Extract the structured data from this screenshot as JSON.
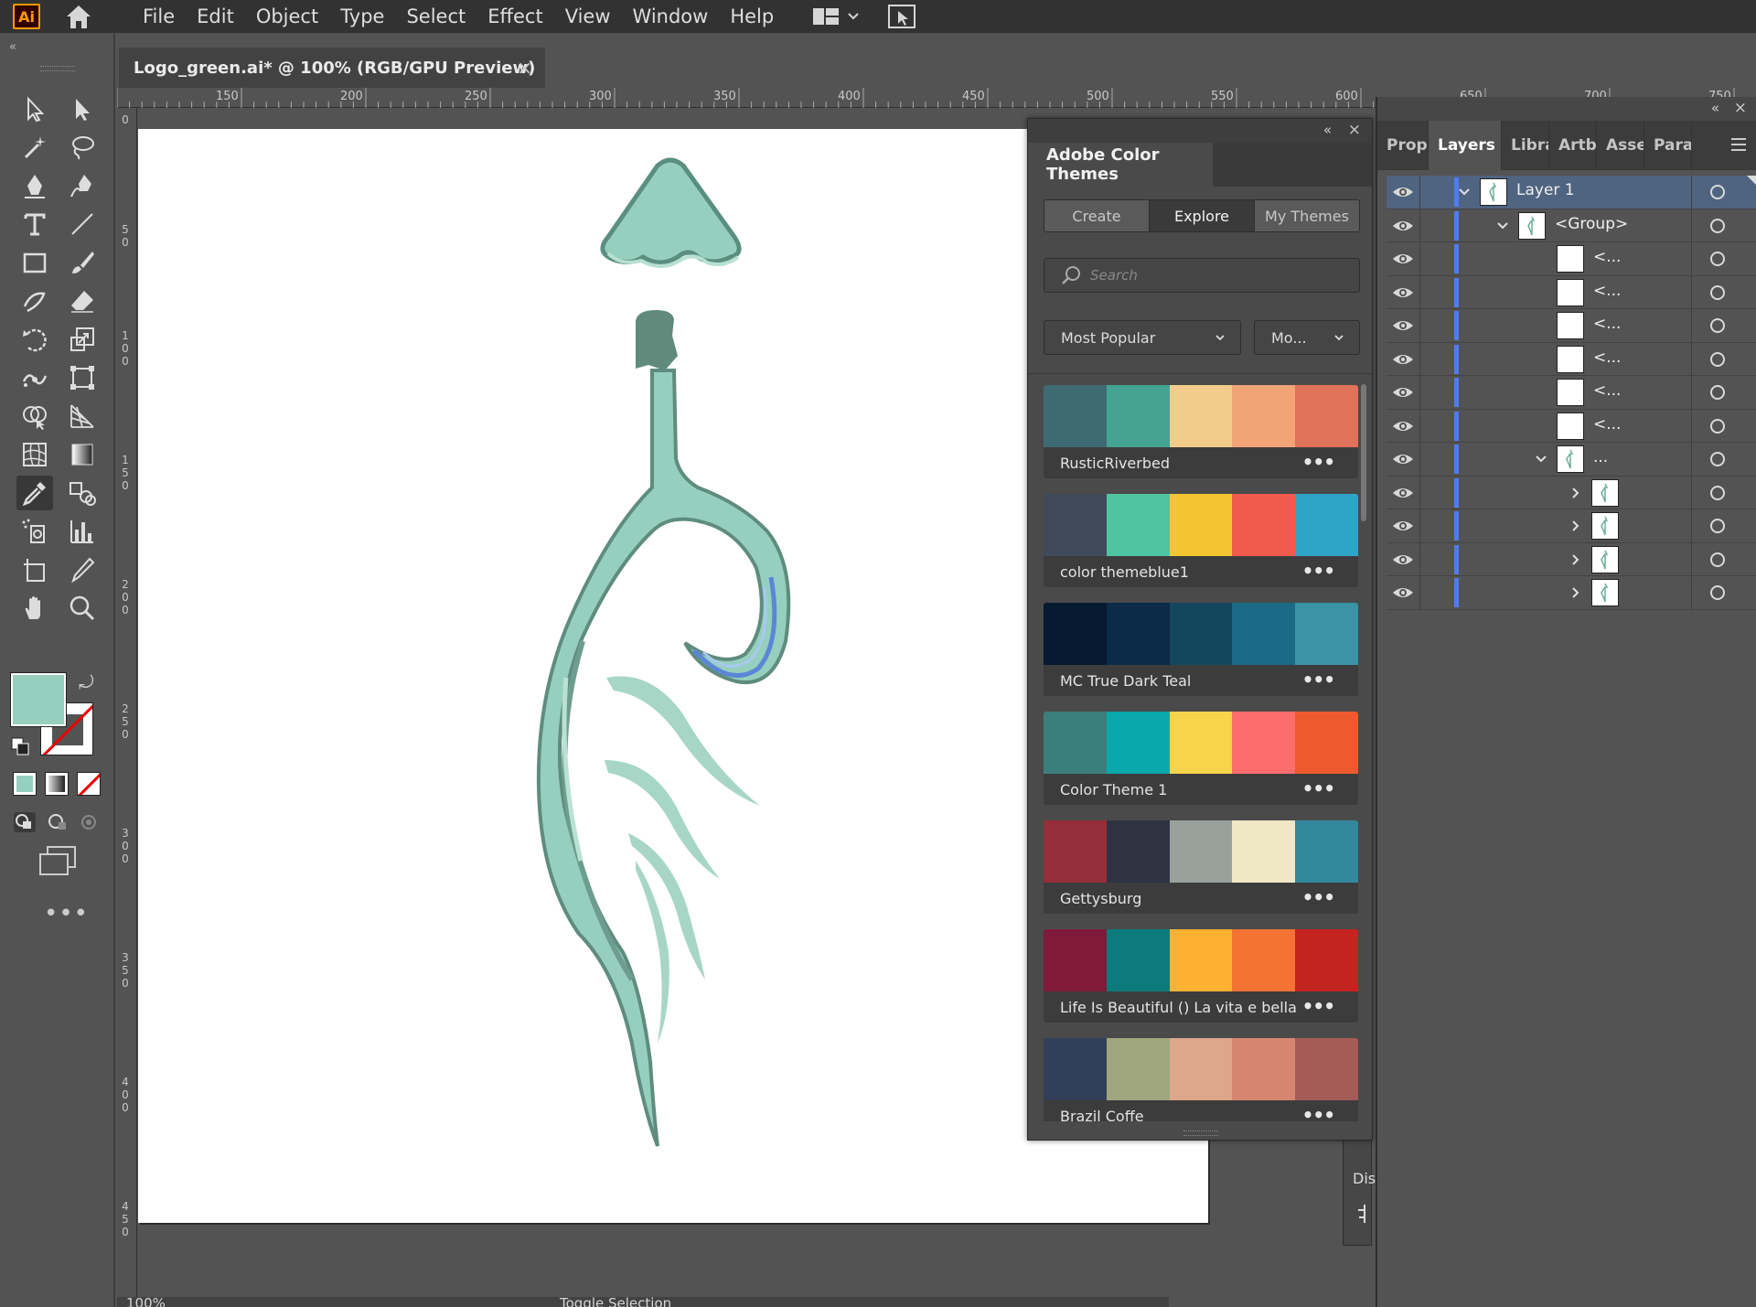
{
  "app": {
    "logo_text": "Ai",
    "menus": [
      "File",
      "Edit",
      "Object",
      "Type",
      "Select",
      "Effect",
      "View",
      "Window",
      "Help"
    ]
  },
  "document": {
    "tab_title": "Logo_green.ai* @ 100% (RGB/GPU Preview)",
    "close_symbol": "×"
  },
  "ruler": {
    "top_labels": [
      "150",
      "200",
      "250",
      "300",
      "350",
      "400",
      "450",
      "500",
      "550",
      "600",
      "650",
      "700",
      "750"
    ],
    "left_labels": [
      "0",
      "50",
      "100",
      "150",
      "200",
      "250",
      "300",
      "350",
      "400",
      "450"
    ]
  },
  "toolbar": {
    "collapse_symbol": "«",
    "more_label": "•••",
    "fill_color": "#97cfbe"
  },
  "status": {
    "zoom": "100%",
    "text": "Toggle Selection"
  },
  "color_themes": {
    "title": "Adobe Color Themes",
    "collapse_symbol": "«",
    "close_symbol": "×",
    "tabs": [
      "Create",
      "Explore",
      "My Themes"
    ],
    "active_tab": "Explore",
    "search_placeholder": "Search",
    "sort_label": "Most Popular",
    "time_label": "Mo...",
    "more_symbol": "•••",
    "themes": [
      {
        "name": "RusticRiverbed",
        "colors": [
          "#3e6b73",
          "#45a391",
          "#f2cc8b",
          "#f2a477",
          "#e07259"
        ]
      },
      {
        "name": "color themeblue1",
        "colors": [
          "#3f4a59",
          "#4fc4a0",
          "#f4c533",
          "#f25a4b",
          "#30a4c7"
        ]
      },
      {
        "name": "MC True Dark Teal",
        "colors": [
          "#061a30",
          "#0b2b47",
          "#14465e",
          "#1b6a86",
          "#3a93a6"
        ]
      },
      {
        "name": "Color Theme 1",
        "colors": [
          "#3b7f7d",
          "#0aa8ad",
          "#f7d44a",
          "#fc6e6c",
          "#ee5a2d"
        ]
      },
      {
        "name": "Gettysburg",
        "colors": [
          "#952d3a",
          "#2f3341",
          "#9aa09b",
          "#efe8c5",
          "#32899d"
        ]
      },
      {
        "name": "Life Is Beautiful () La vita e bella",
        "colors": [
          "#80193a",
          "#0c7b7c",
          "#fdb131",
          "#f47233",
          "#c42420"
        ]
      },
      {
        "name": "Brazil Coffe",
        "colors": [
          "#323f5a",
          "#9fa67d",
          "#dea68a",
          "#d78470",
          "#a65c56"
        ]
      }
    ]
  },
  "dock": {
    "label": "Dis"
  },
  "layers": {
    "collapse_symbol": "«",
    "close_symbol": "×",
    "tabs": [
      "Prop",
      "Layers",
      "Libra",
      "Artb",
      "Asse",
      "Para"
    ],
    "active_tab": "Layers",
    "rows": [
      {
        "name": "Layer 1",
        "indent": 0,
        "expander": "down",
        "selected": true
      },
      {
        "name": "<Group>",
        "indent": 1,
        "expander": "down",
        "selected": false
      },
      {
        "name": "<...",
        "indent": 2,
        "expander": "none",
        "selected": false
      },
      {
        "name": "<...",
        "indent": 2,
        "expander": "none",
        "selected": false
      },
      {
        "name": "<...",
        "indent": 2,
        "expander": "none",
        "selected": false
      },
      {
        "name": "<...",
        "indent": 2,
        "expander": "none",
        "selected": false
      },
      {
        "name": "<...",
        "indent": 2,
        "expander": "none",
        "selected": false
      },
      {
        "name": "<...",
        "indent": 2,
        "expander": "none",
        "selected": false
      },
      {
        "name": "...",
        "indent": 2,
        "expander": "down",
        "selected": false
      },
      {
        "name": "",
        "indent": 3,
        "expander": "right",
        "selected": false
      },
      {
        "name": "",
        "indent": 3,
        "expander": "right",
        "selected": false
      },
      {
        "name": "",
        "indent": 3,
        "expander": "right",
        "selected": false
      },
      {
        "name": "",
        "indent": 3,
        "expander": "right",
        "selected": false
      }
    ]
  }
}
